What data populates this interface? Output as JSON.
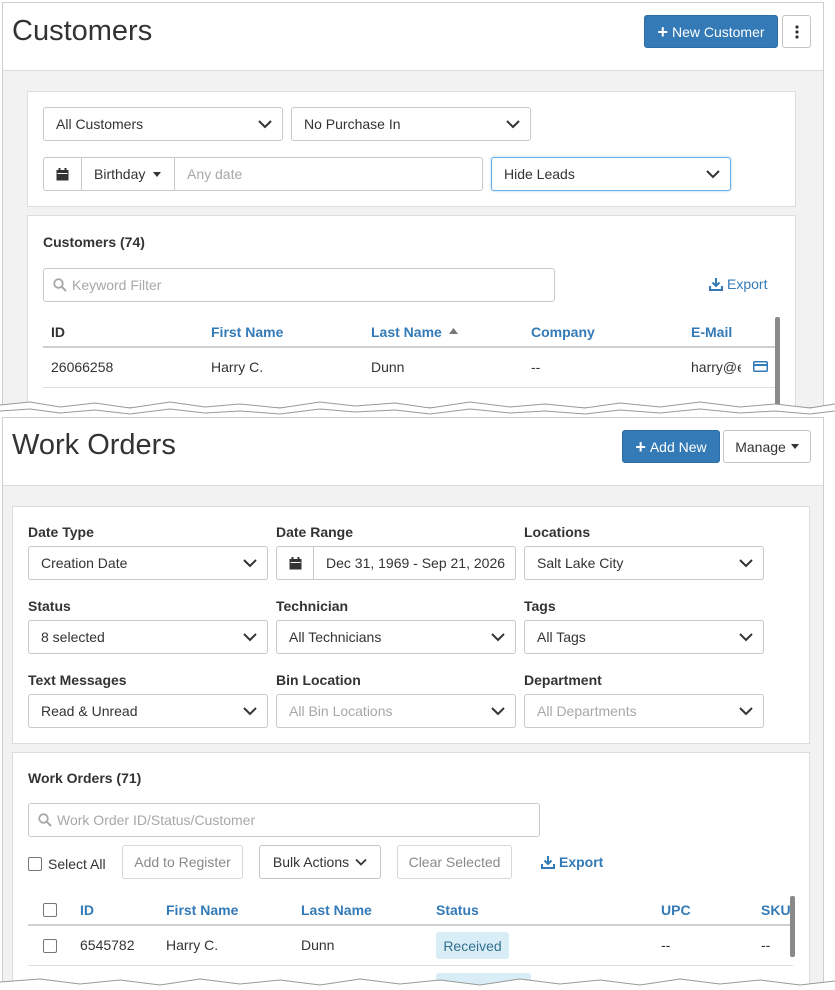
{
  "customers": {
    "title": "Customers",
    "new_button": "New Customer",
    "filters": {
      "customer_type": "All Customers",
      "purchase": "No Purchase In",
      "date_field": "Birthday",
      "date_placeholder": "Any date",
      "leads": "Hide Leads"
    },
    "list": {
      "title": "Customers (74)",
      "search_placeholder": "Keyword Filter",
      "export": "Export",
      "columns": [
        "ID",
        "First Name",
        "Last Name",
        "Company",
        "E-Mail"
      ],
      "rows": [
        {
          "id": "26066258",
          "first": "Harry C.",
          "last": "Dunn",
          "company": "--",
          "email": "harry@e"
        }
      ]
    }
  },
  "work_orders": {
    "title": "Work Orders",
    "add_button": "Add New",
    "manage_button": "Manage",
    "filters": {
      "date_type_label": "Date Type",
      "date_type": "Creation Date",
      "date_range_label": "Date Range",
      "date_range": "Dec 31, 1969 - Sep 21, 2026",
      "locations_label": "Locations",
      "locations": "Salt Lake City",
      "status_label": "Status",
      "status": "8 selected",
      "technician_label": "Technician",
      "technician": "All Technicians",
      "tags_label": "Tags",
      "tags": "All Tags",
      "text_messages_label": "Text Messages",
      "text_messages": "Read & Unread",
      "bin_location_label": "Bin Location",
      "bin_location": "All Bin Locations",
      "department_label": "Department",
      "department": "All Departments"
    },
    "list": {
      "title": "Work Orders (71)",
      "search_placeholder": "Work Order ID/Status/Customer",
      "select_all": "Select All",
      "add_to_register": "Add to Register",
      "bulk_actions": "Bulk Actions",
      "clear_selected": "Clear Selected",
      "export": "Export",
      "columns": [
        "ID",
        "First Name",
        "Last Name",
        "Status",
        "UPC",
        "SKU"
      ],
      "rows": [
        {
          "id": "6545782",
          "first": "Harry C.",
          "last": "Dunn",
          "status": "Received",
          "upc": "--",
          "sku": "--"
        }
      ]
    }
  },
  "colors": {
    "primary": "#337ab7",
    "link": "#337ab7",
    "badge_bg": "#d9edf7"
  }
}
